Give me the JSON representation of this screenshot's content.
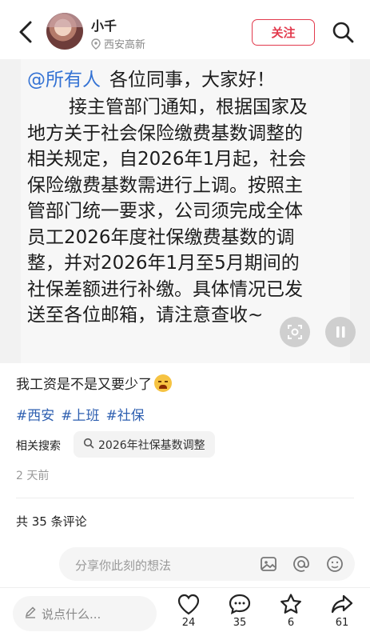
{
  "header": {
    "username": "小千",
    "location": "西安高新",
    "follow_label": "关注"
  },
  "post_image": {
    "mention": "@所有人",
    "greeting": "各位同事，大家好！",
    "lines": [
      "接主管部门通知，根据国家及",
      "地方关于社会保险缴费基数调整的",
      "相关规定，自2026年1月起，社会",
      "保险缴费基数需进行上调。按照主",
      "管部门统一要求，公司须完成全体",
      "员工2026年度社保缴费基数的调",
      "整，并对2026年1月至5月期间的",
      "社保差额进行补缴。具体情况已发",
      "送至各位邮箱，请注意查收~"
    ]
  },
  "post": {
    "caption": "我工资是不是又要少了",
    "tags": [
      "#西安",
      "#上班",
      "#社保"
    ],
    "related_label": "相关搜索",
    "related_query": "2026年社保基数调整",
    "time": "2 天前"
  },
  "comments": {
    "count_text": "共 35 条评论",
    "input_placeholder": "分享你此刻的想法"
  },
  "bottom": {
    "say_placeholder": "说点什么...",
    "like_count": "24",
    "comment_count": "35",
    "star_count": "6",
    "share_count": "61"
  },
  "colors": {
    "accent": "#e23a4d",
    "link": "#3573d4",
    "tag": "#2e5fb0"
  }
}
